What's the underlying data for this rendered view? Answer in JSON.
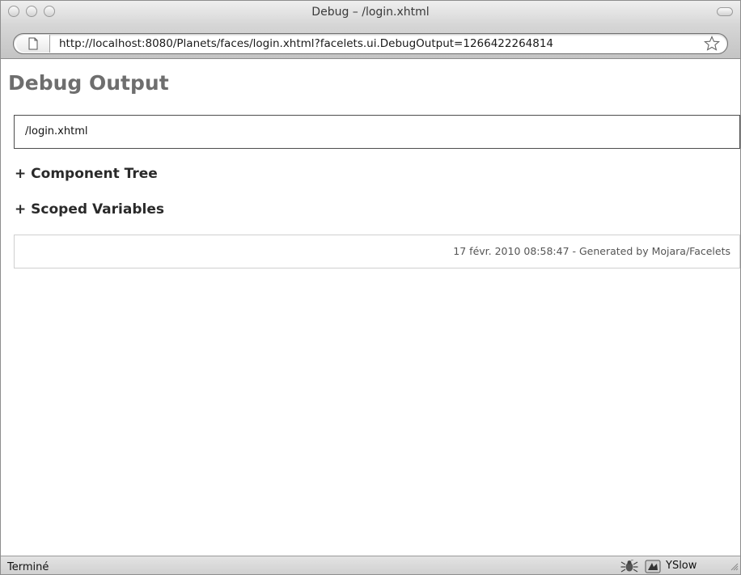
{
  "window": {
    "title": "Debug – /login.xhtml"
  },
  "toolbar": {
    "url": "http://localhost:8080/Planets/faces/login.xhtml?facelets.ui.DebugOutput=1266422264814"
  },
  "page": {
    "heading": "Debug Output",
    "view_id": "/login.xhtml",
    "component_tree_label": "+ Component Tree",
    "scoped_variables_label": "+ Scoped Variables",
    "footer": "17 févr. 2010 08:58:47 - Generated by Mojara/Facelets"
  },
  "statusbar": {
    "status": "Terminé",
    "yslow_label": "YSlow",
    "icons": [
      "firebug-icon",
      "yslow-icon"
    ]
  },
  "colors": {
    "heading": "#6e6e6e",
    "chrome": "#d6d6d6"
  }
}
